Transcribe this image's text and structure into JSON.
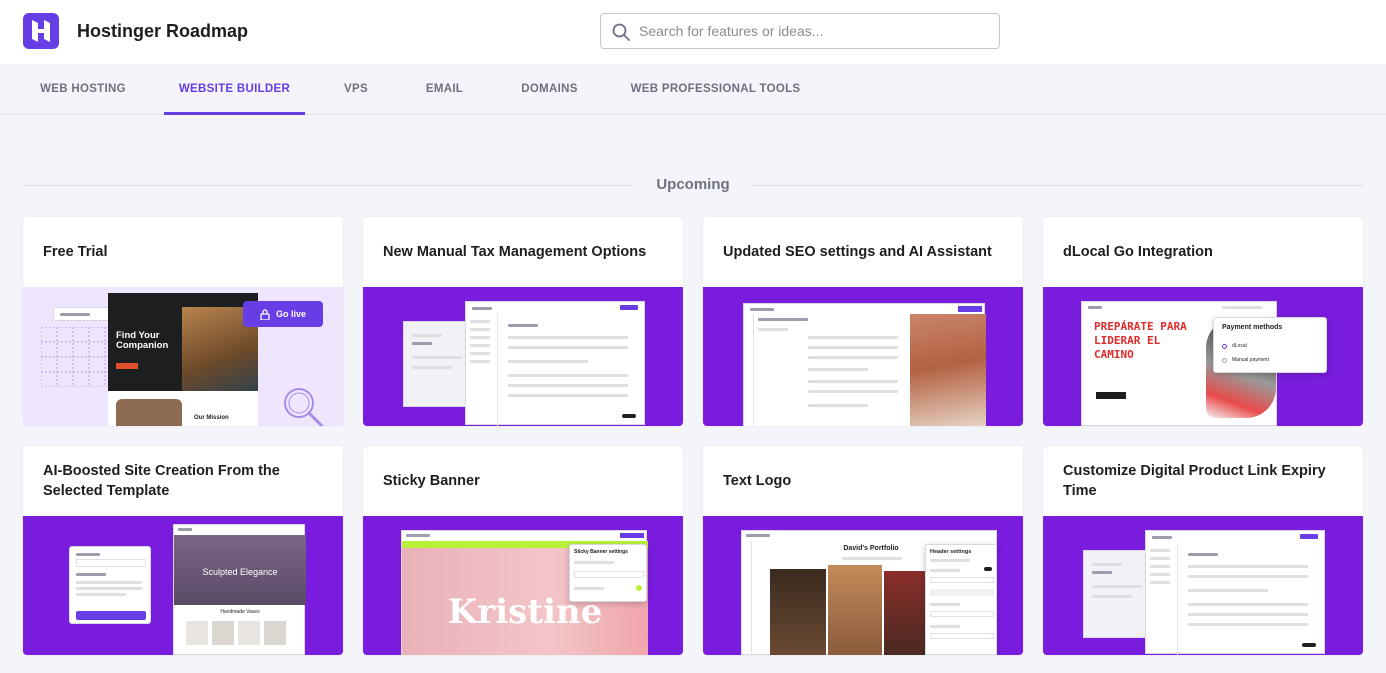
{
  "header": {
    "app_title": "Hostinger Roadmap",
    "search_placeholder": "Search for features or ideas...",
    "brand_color": "#673de6"
  },
  "tabs": [
    {
      "label": "WEB HOSTING",
      "active": false
    },
    {
      "label": "WEBSITE BUILDER",
      "active": true
    },
    {
      "label": "VPS",
      "active": false
    },
    {
      "label": "EMAIL",
      "active": false
    },
    {
      "label": "DOMAINS",
      "active": false
    },
    {
      "label": "WEB PROFESSIONAL TOOLS",
      "active": false
    }
  ],
  "section": {
    "title": "Upcoming"
  },
  "cards": [
    {
      "title": "Free Trial",
      "preview": {
        "hero_title": "Find Your Companion",
        "badge": "Go live",
        "section_label": "Our Mission"
      }
    },
    {
      "title": "New Manual Tax Management Options"
    },
    {
      "title": "Updated SEO settings and AI Assistant"
    },
    {
      "title": "dLocal Go Integration",
      "preview": {
        "poster_text": "PREPÁRATE PARA LIDERAR EL CAMINO",
        "panel_title": "Payment methods",
        "option_1": "dLocal",
        "option_2": "Manual payment"
      }
    },
    {
      "title": "AI-Boosted Site Creation From the Selected Template",
      "preview": {
        "hero_title": "Sculpted Elegance",
        "section_label": "Handmade Vases"
      }
    },
    {
      "title": "Sticky Banner",
      "preview": {
        "hero_name": "Kristine",
        "panel_title": "Sticky Banner settings"
      }
    },
    {
      "title": "Text Logo",
      "preview": {
        "site_name": "David's Portfolio",
        "panel_title": "Header settings"
      }
    },
    {
      "title": "Customize Digital Product Link Expiry Time"
    }
  ]
}
